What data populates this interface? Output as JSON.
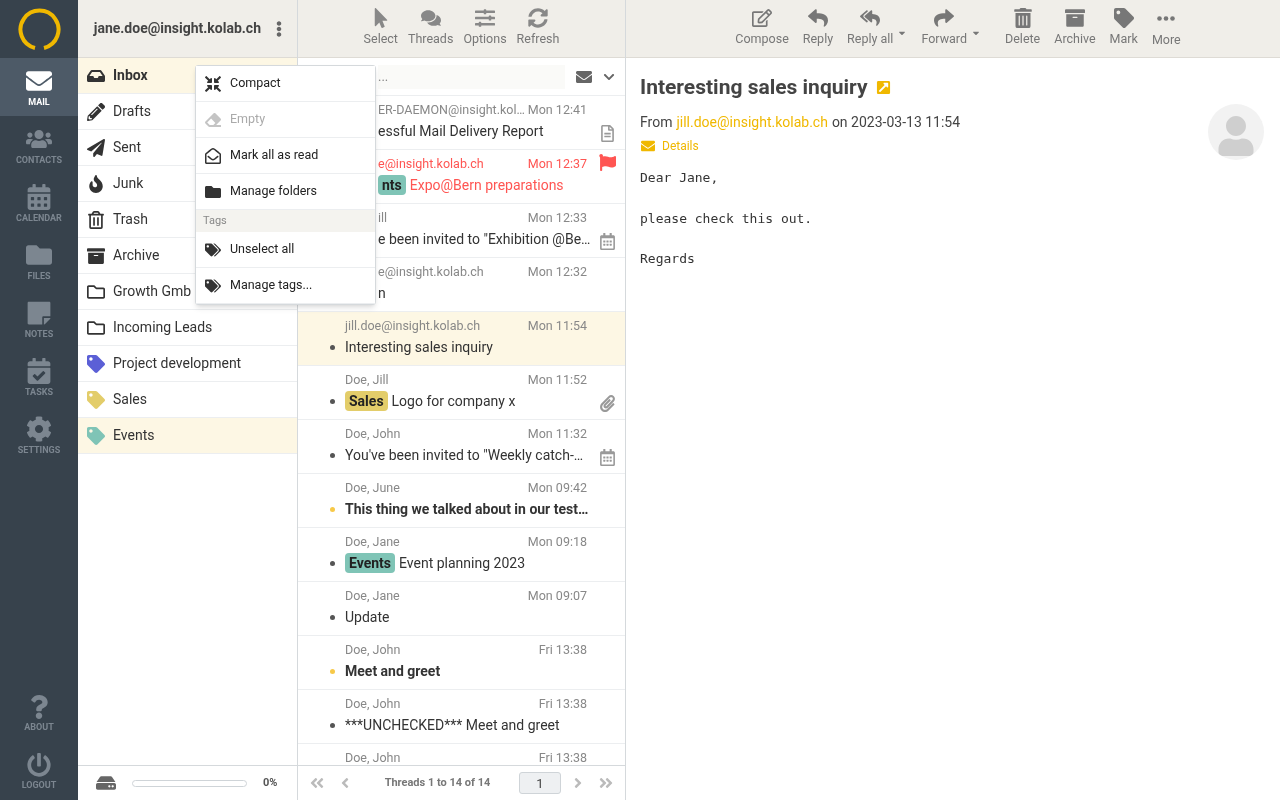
{
  "nav": {
    "items": [
      {
        "label": "MAIL",
        "selected": true
      },
      {
        "label": "CONTACTS",
        "selected": false
      },
      {
        "label": "CALENDAR",
        "selected": false
      },
      {
        "label": "FILES",
        "selected": false
      },
      {
        "label": "NOTES",
        "selected": false
      },
      {
        "label": "TASKS",
        "selected": false
      },
      {
        "label": "SETTINGS",
        "selected": false
      }
    ],
    "bottom": [
      {
        "label": "ABOUT"
      },
      {
        "label": "LOGOUT"
      }
    ]
  },
  "account": "jane.doe@insight.kolab.ch",
  "folders": [
    {
      "kind": "mailbox",
      "label": "Inbox",
      "selected": true
    },
    {
      "kind": "mailbox",
      "label": "Drafts",
      "selected": false
    },
    {
      "kind": "mailbox",
      "label": "Sent",
      "selected": false
    },
    {
      "kind": "mailbox",
      "label": "Junk",
      "selected": false
    },
    {
      "kind": "mailbox",
      "label": "Trash",
      "selected": false
    },
    {
      "kind": "mailbox",
      "label": "Archive",
      "selected": false
    },
    {
      "kind": "folder",
      "label": "Growth Gmb",
      "selected": false
    },
    {
      "kind": "folder",
      "label": "Incoming Leads",
      "selected": false
    },
    {
      "kind": "tag",
      "label": "Project development",
      "color": "#5b5fd6",
      "selected": false
    },
    {
      "kind": "tag",
      "label": "Sales",
      "color": "#e3cd6a",
      "selected": false
    },
    {
      "kind": "tag",
      "label": "Events",
      "color": "#7fc4b6",
      "selected": true
    }
  ],
  "quota": {
    "level": 0,
    "reading": "0%"
  },
  "folder_menu": {
    "items": [
      {
        "kind": "action",
        "label": "Compact",
        "disabled": false
      },
      {
        "kind": "action",
        "label": "Empty",
        "disabled": true
      },
      {
        "kind": "action",
        "label": "Mark all as read",
        "disabled": false
      },
      {
        "kind": "action",
        "label": "Manage folders",
        "disabled": false
      },
      {
        "kind": "section",
        "label": "Tags"
      },
      {
        "kind": "action",
        "label": "Unselect all",
        "disabled": false
      },
      {
        "kind": "action",
        "label": "Manage tags...",
        "disabled": false
      }
    ]
  },
  "list_toolbar": [
    {
      "label": "Select"
    },
    {
      "label": "Threads"
    },
    {
      "label": "Options"
    },
    {
      "label": "Refresh"
    }
  ],
  "search": {
    "placeholder": "..."
  },
  "messages": [
    {
      "from": "ER-DAEMON@insight.kol…",
      "date": "Mon 12:41",
      "subject": "essful Mail Delivery Report",
      "covered": true,
      "unread": false,
      "flagged": false,
      "selected": false
    },
    {
      "from": "e@insight.kolab.ch",
      "date": "Mon 12:37",
      "tag": {
        "label": "nts",
        "color": "#7fc4b6"
      },
      "subject": "Expo@Bern preparations",
      "covered": true,
      "unread": false,
      "flagged": true,
      "selected": false
    },
    {
      "from": "ill",
      "date": "Mon 12:33",
      "subject": "e been invited to \"Exhibition @Be…",
      "covered": true,
      "unread": false,
      "flagged": false,
      "selected": false
    },
    {
      "from": "e@insight.kolab.ch",
      "date": "Mon 12:32",
      "subject": "n",
      "covered": true,
      "unread": false,
      "flagged": false,
      "selected": false
    },
    {
      "from": "jill.doe@insight.kolab.ch",
      "date": "Mon 11:54",
      "subject": "Interesting sales inquiry",
      "covered": false,
      "unread": false,
      "flagged": false,
      "selected": true
    },
    {
      "from": "Doe, Jill",
      "date": "Mon 11:52",
      "tag": {
        "label": "Sales",
        "color": "#e3cd6a"
      },
      "subject": "Logo for company x",
      "covered": false,
      "unread": false,
      "flagged": false,
      "selected": false
    },
    {
      "from": "Doe, John",
      "date": "Mon 11:32",
      "subject": "You've been invited to \"Weekly catch-…",
      "covered": false,
      "unread": false,
      "flagged": false,
      "selected": false
    },
    {
      "from": "Doe, June",
      "date": "Mon 09:42",
      "subject": "This thing we talked about in our test…",
      "covered": false,
      "unread": true,
      "flagged": false,
      "selected": false
    },
    {
      "from": "Doe, Jane",
      "date": "Mon 09:18",
      "tag": {
        "label": "Events",
        "color": "#7fc4b6"
      },
      "subject": "Event planning 2023",
      "covered": false,
      "unread": false,
      "flagged": false,
      "selected": false
    },
    {
      "from": "Doe, Jane",
      "date": "Mon 09:07",
      "subject": "Update",
      "covered": false,
      "unread": false,
      "flagged": false,
      "selected": false
    },
    {
      "from": "Doe, John",
      "date": "Fri 13:38",
      "subject": "Meet and greet",
      "covered": false,
      "unread": true,
      "flagged": false,
      "selected": false
    },
    {
      "from": "Doe, John",
      "date": "Fri 13:38",
      "subject": "***UNCHECKED*** Meet and greet",
      "covered": false,
      "unread": false,
      "flagged": false,
      "selected": false
    },
    {
      "from": "Doe, John",
      "date": "Fri 13:38",
      "covered": false,
      "flagged": false,
      "selected": false
    }
  ],
  "pager": {
    "text": "Threads 1 to 14 of 14",
    "page": "1"
  },
  "message_toolbar": [
    {
      "label": "Compose",
      "dropdown": false
    },
    {
      "label": "Reply",
      "dropdown": false
    },
    {
      "label": "Reply all",
      "dropdown": true
    },
    {
      "label": "Forward",
      "dropdown": true
    },
    {
      "label": "Delete",
      "dropdown": false
    },
    {
      "label": "Archive",
      "dropdown": false
    },
    {
      "label": "Mark",
      "dropdown": false
    },
    {
      "label": "More",
      "dropdown": false
    }
  ],
  "message": {
    "subject": "Interesting sales inquiry",
    "from_prefix": "From",
    "from": "jill.doe@insight.kolab.ch",
    "date": "on 2023-03-13 11:54",
    "details": "Details",
    "body": [
      "Dear Jane,",
      "please check this out.",
      "Regards"
    ]
  }
}
